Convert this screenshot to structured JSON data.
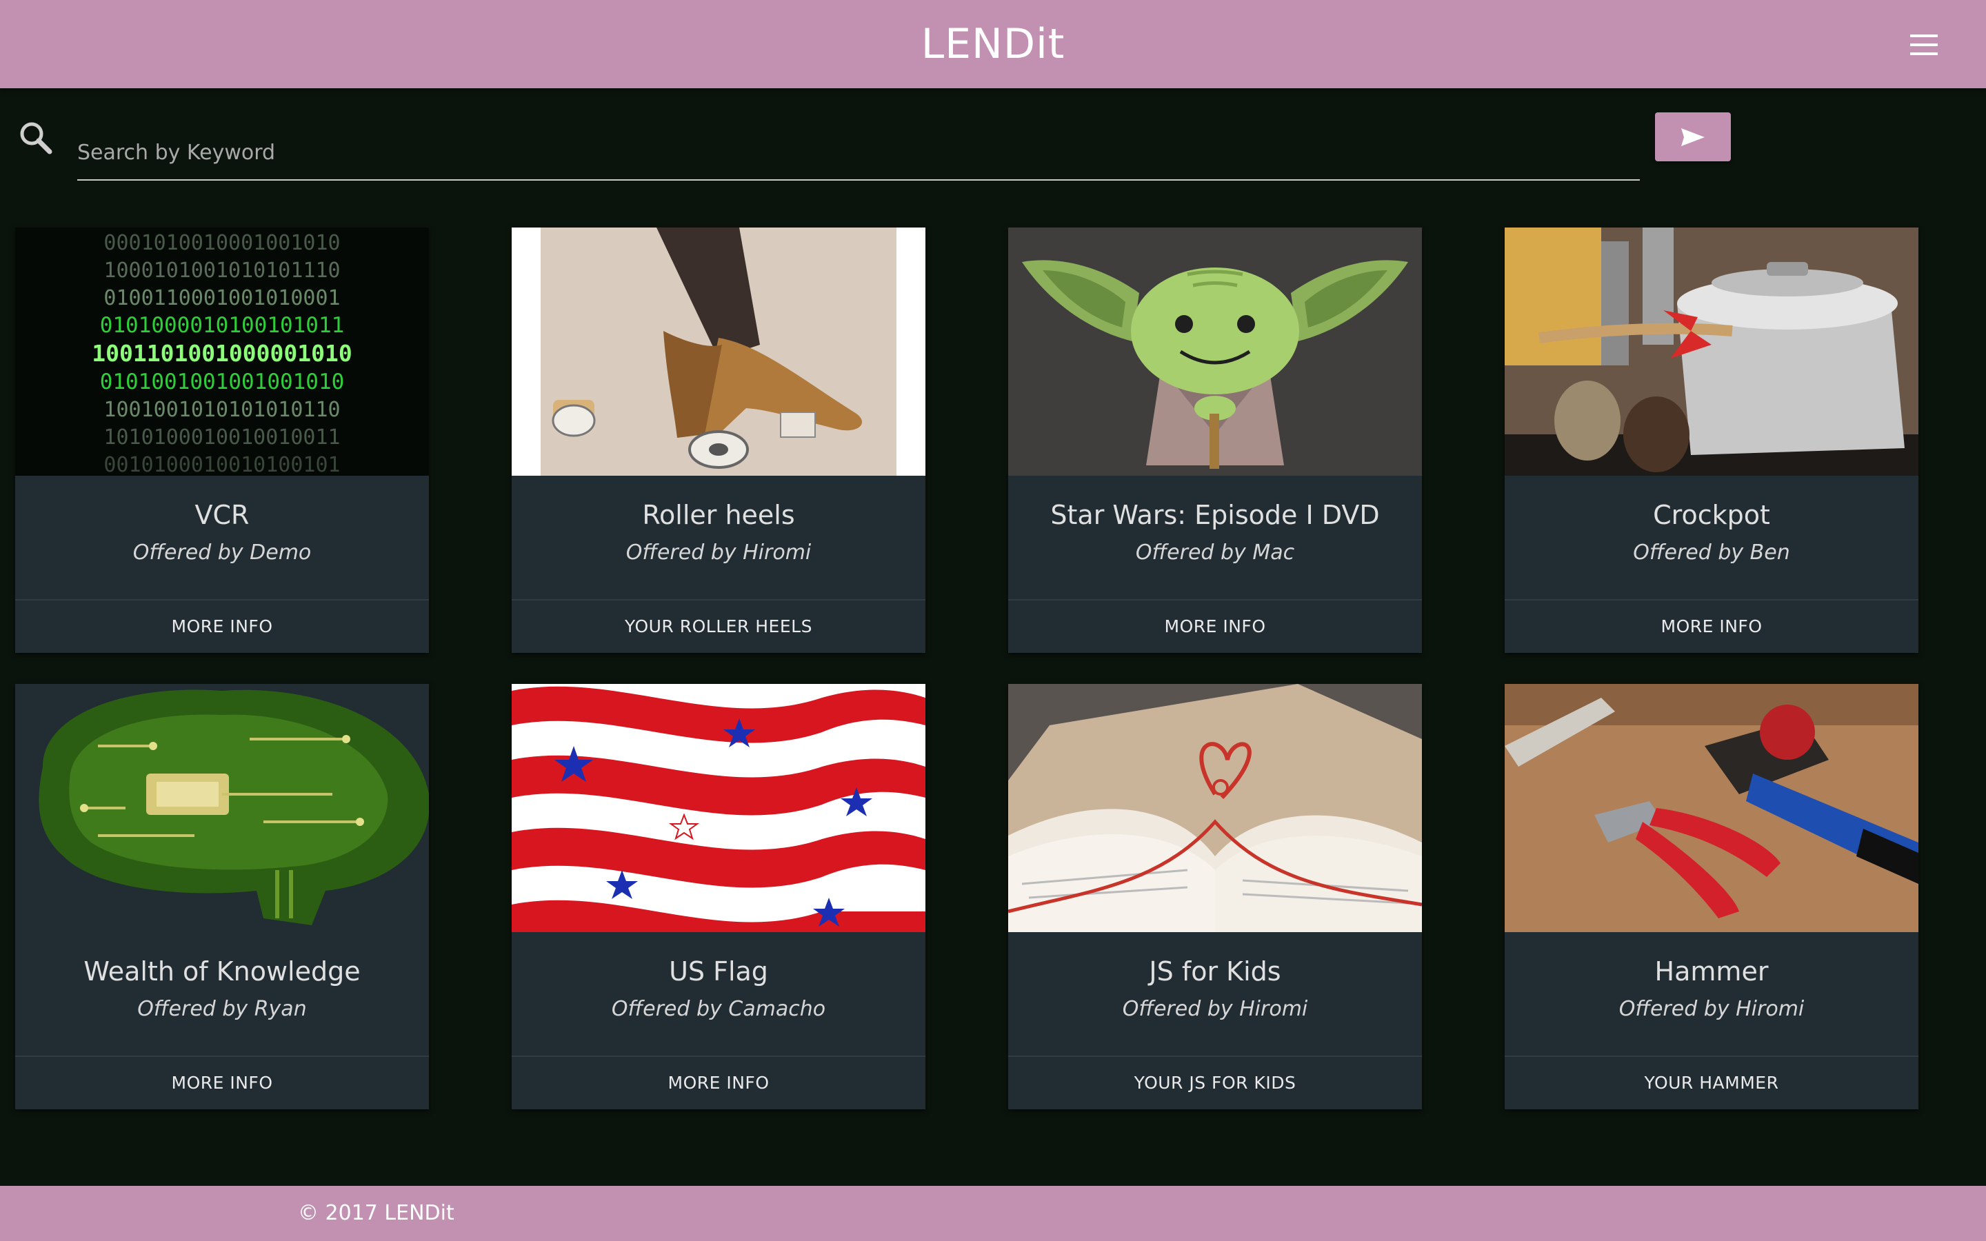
{
  "header": {
    "brand": "LENDit",
    "menu_icon": "hamburger-menu-icon"
  },
  "search": {
    "placeholder": "Search by Keyword",
    "value": "",
    "icon": "search-icon",
    "submit_icon": "send-arrow-icon"
  },
  "cards": [
    {
      "title": "VCR",
      "owner": "Offered by Demo",
      "action": "MORE INFO"
    },
    {
      "title": "Roller heels",
      "owner": "Offered by Hiromi",
      "action": "YOUR ROLLER HEELS"
    },
    {
      "title": "Star Wars: Episode I DVD",
      "owner": "Offered by Mac",
      "action": "MORE INFO"
    },
    {
      "title": "Crockpot",
      "owner": "Offered by Ben",
      "action": "MORE INFO"
    },
    {
      "title": "Wealth of Knowledge",
      "owner": "Offered by Ryan",
      "action": "MORE INFO"
    },
    {
      "title": "US Flag",
      "owner": "Offered by Camacho",
      "action": "MORE INFO"
    },
    {
      "title": "JS for Kids",
      "owner": "Offered by Hiromi",
      "action": "YOUR JS FOR KIDS"
    },
    {
      "title": "Hammer",
      "owner": "Offered by Hiromi",
      "action": "YOUR HAMMER"
    }
  ],
  "footer": {
    "text": "© 2017 LENDit"
  },
  "colors": {
    "brand": "#c290b1",
    "background": "#0b140c",
    "card": "#212c33"
  }
}
